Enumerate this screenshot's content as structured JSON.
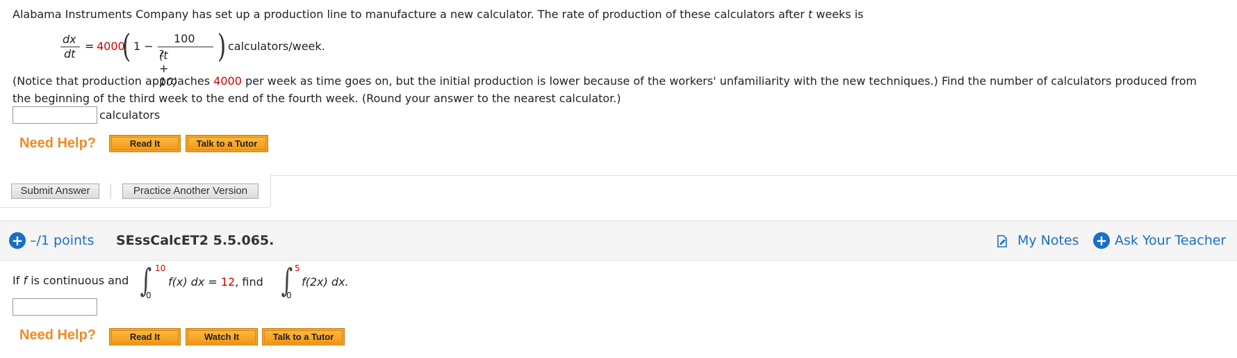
{
  "q1": {
    "intro": "Alabama Instruments Company has set up a production line to manufacture a new calculator. The rate of production of these calculators after",
    "intro_var": "t",
    "intro_end": "weeks is",
    "eq": {
      "dx": "dx",
      "dt": "dt",
      "equals": "=",
      "coef": "4000",
      "one_minus": "1 −",
      "num": "100",
      "den": "(t + 10)",
      "den_exp": "2",
      "units": "calculators/week."
    },
    "notice_pre": "(Notice that production approaches",
    "notice_val": "4000",
    "notice_post": "per week as time goes on, but the initial production is lower because of the workers' unfamiliarity with the new techniques.) Find the number of calculators produced from",
    "notice_line2": "the beginning of the third week to the end of the fourth week. (Round your answer to the nearest calculator.)",
    "answer_value": "",
    "answer_unit": "calculators",
    "need_help": "Need Help?",
    "buttons": [
      "Read It",
      "Talk to a Tutor"
    ],
    "submit": "Submit Answer",
    "practice": "Practice Another Version"
  },
  "q2": {
    "points": "–/1 points",
    "code": "SEssCalcET2 5.5.065.",
    "my_notes": "My Notes",
    "ask_teacher": "Ask Your Teacher",
    "text_pre": "If",
    "text_f": "f",
    "text_mid": "is continuous and",
    "int1_upper": "10",
    "int1_lower": "0",
    "int1_body": "f(x) dx",
    "int1_equals": "=",
    "int1_value": "12",
    "comma_find": ",  find",
    "int2_upper": "5",
    "int2_lower": "0",
    "int2_body": "f(2x) dx.",
    "answer_value": "",
    "need_help": "Need Help?",
    "buttons": [
      "Read It",
      "Watch It",
      "Talk to a Tutor"
    ]
  },
  "colors": {
    "accent_red": "#d10000",
    "help_orange": "#ef8b24",
    "link_blue": "#1a6fc3"
  },
  "icons": {
    "add": "plus-circle-icon",
    "notes": "notes-icon"
  }
}
